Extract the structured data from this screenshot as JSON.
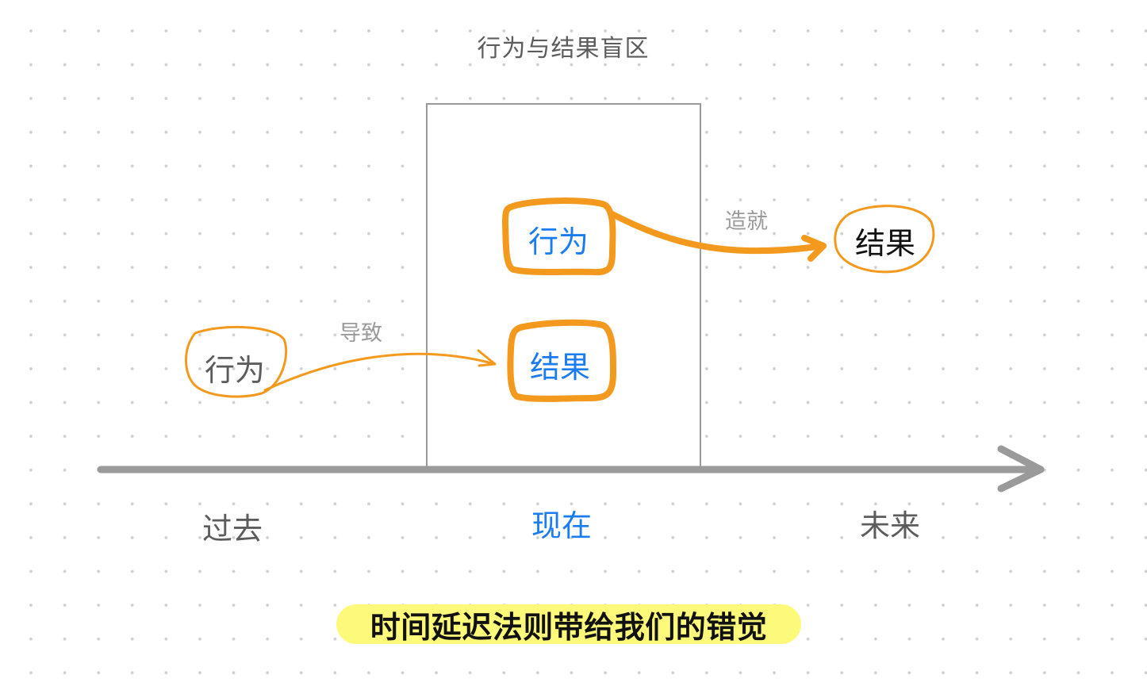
{
  "diagram": {
    "title": "行为与结果盲区",
    "present_box": {
      "nodes": [
        {
          "id": "present-behavior",
          "label": "行为"
        },
        {
          "id": "present-result",
          "label": "结果"
        }
      ]
    },
    "past_node": {
      "label": "行为"
    },
    "future_node": {
      "label": "结果"
    },
    "edges": [
      {
        "from": "past-behavior",
        "to": "present-result",
        "label": "导致"
      },
      {
        "from": "present-behavior",
        "to": "future-result",
        "label": "造就"
      }
    ],
    "timeline": {
      "past": "过去",
      "present": "现在",
      "future": "未来"
    },
    "caption": "时间延迟法则带给我们的错觉"
  },
  "colors": {
    "accent_orange": "#f39a1e",
    "highlight_blue": "#1b7cf0",
    "axis_gray": "#9a9a9a",
    "caption_highlight": "#fdf97a"
  }
}
